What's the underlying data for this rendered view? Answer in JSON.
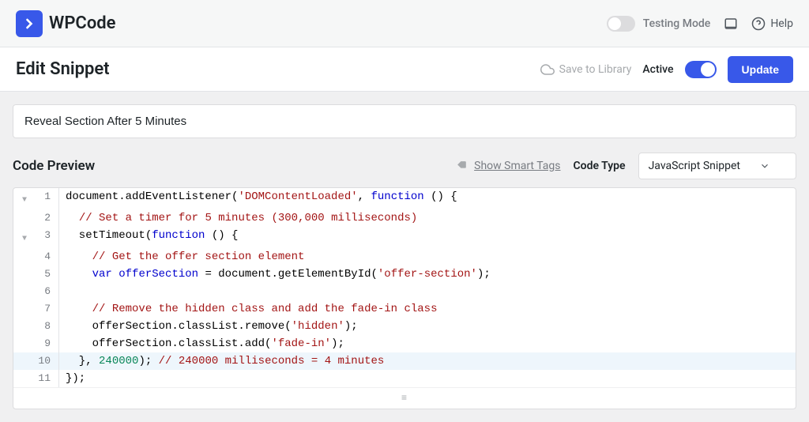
{
  "header": {
    "logo_text": "WPCode",
    "testing_mode_label": "Testing Mode",
    "help_label": "Help"
  },
  "action_bar": {
    "title": "Edit Snippet",
    "save_library_label": "Save to Library",
    "active_label": "Active",
    "update_label": "Update"
  },
  "snippet": {
    "title_value": "Reveal Section After 5 Minutes"
  },
  "preview": {
    "title": "Code Preview",
    "smart_tags_label": "Show Smart Tags",
    "code_type_label": "Code Type",
    "code_type_value": "JavaScript Snippet"
  },
  "code_lines": [
    {
      "n": "1",
      "fold": "▼",
      "html": "document.addEventListener(<span class=\"c-string\">'DOMContentLoaded'</span>, <span class=\"c-keyword\">function</span> () {"
    },
    {
      "n": "2",
      "fold": "",
      "html": "  <span class=\"c-comment\">// Set a timer for 5 minutes (300,000 milliseconds)</span>"
    },
    {
      "n": "3",
      "fold": "▼",
      "html": "  setTimeout(<span class=\"c-keyword\">function</span> () {"
    },
    {
      "n": "4",
      "fold": "",
      "html": "    <span class=\"c-comment\">// Get the offer section element</span>"
    },
    {
      "n": "5",
      "fold": "",
      "html": "    <span class=\"c-keyword\">var</span> <span class=\"c-var\">offerSection</span> = document.getElementById(<span class=\"c-string\">'offer-section'</span>);"
    },
    {
      "n": "6",
      "fold": "",
      "html": ""
    },
    {
      "n": "7",
      "fold": "",
      "html": "    <span class=\"c-comment\">// Remove the hidden class and add the fade-in class</span>"
    },
    {
      "n": "8",
      "fold": "",
      "html": "    offerSection.classList.remove(<span class=\"c-string\">'hidden'</span>);"
    },
    {
      "n": "9",
      "fold": "",
      "html": "    offerSection.classList.add(<span class=\"c-string\">'fade-in'</span>);"
    },
    {
      "n": "10",
      "fold": "",
      "hl": true,
      "html": "  }, <span class=\"c-num\">240000</span>); <span class=\"c-comment\">// 240000 milliseconds = 4 minutes</span>"
    },
    {
      "n": "11",
      "fold": "",
      "html": "});"
    }
  ]
}
